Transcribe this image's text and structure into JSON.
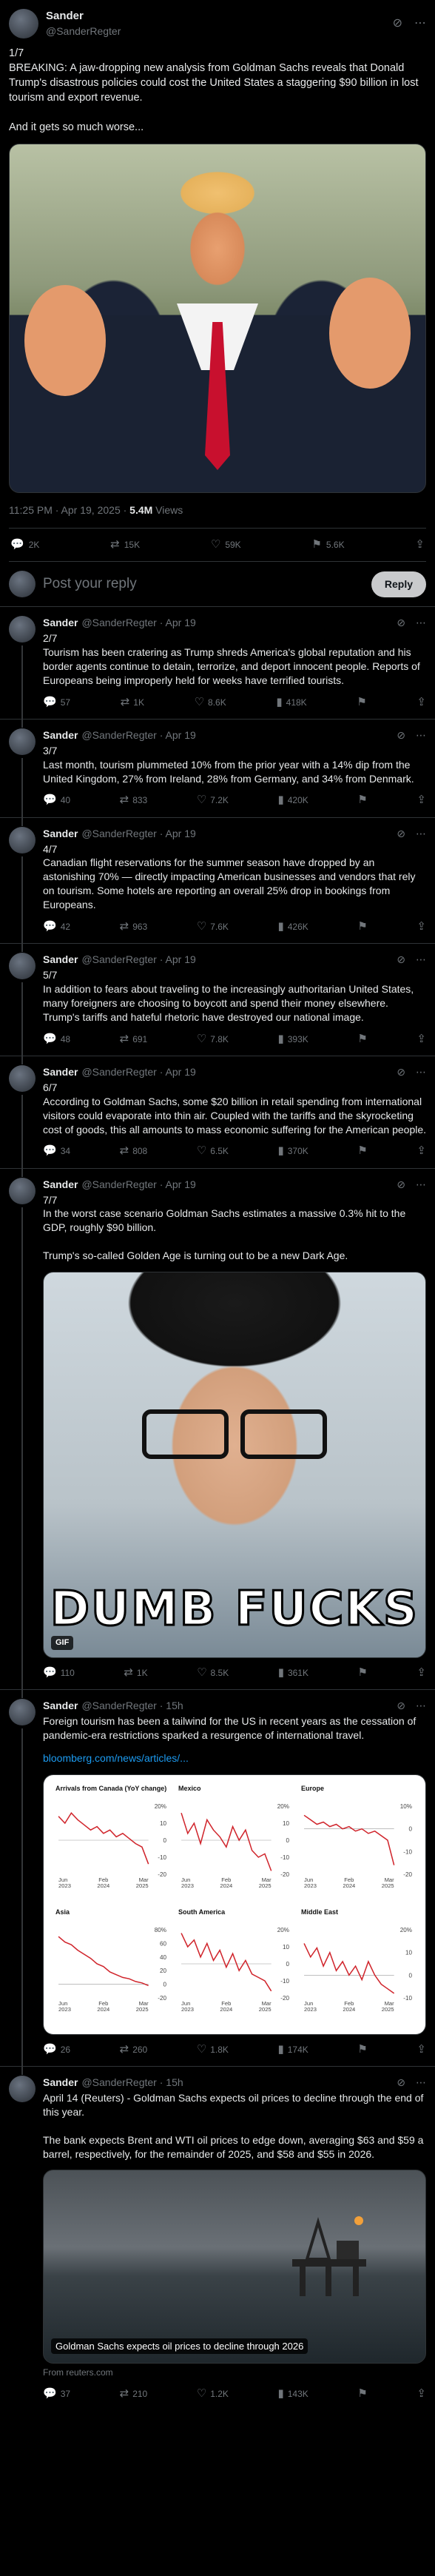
{
  "main": {
    "name": "Sander",
    "handle": "@SanderRegter",
    "text": "1/7\nBREAKING: A jaw-dropping new analysis from Goldman Sachs reveals that Donald Trump's disastrous policies could cost the United States a staggering $90 billion in lost tourism and export revenue.\n\nAnd it gets so much worse...",
    "time": "11:25 PM · Apr 19, 2025 · ",
    "views_count": "5.4M",
    "views_label": " Views",
    "replies": "2K",
    "reposts": "15K",
    "likes": "59K",
    "bookmarks": "5.6K"
  },
  "reply_box": {
    "placeholder": "Post your reply",
    "button": "Reply"
  },
  "thread": [
    {
      "name": "Sander",
      "handle": "@SanderRegter · Apr 19",
      "text": "2/7\nTourism has been cratering as Trump shreds America's global reputation and his border agents continue to detain, terrorize, and deport innocent people. Reports of Europeans being improperly held for weeks have terrified tourists.",
      "replies": "57",
      "reposts": "1K",
      "likes": "8.6K",
      "views": "418K"
    },
    {
      "name": "Sander",
      "handle": "@SanderRegter · Apr 19",
      "text": "3/7\nLast month, tourism plummeted 10% from the prior year with a 14% dip from the United Kingdom, 27% from Ireland, 28% from Germany, and 34% from Denmark.",
      "replies": "40",
      "reposts": "833",
      "likes": "7.2K",
      "views": "420K"
    },
    {
      "name": "Sander",
      "handle": "@SanderRegter · Apr 19",
      "text": "4/7\nCanadian flight reservations for the summer season have dropped by an astonishing 70% — directly impacting American businesses and vendors that rely on tourism. Some hotels are reporting an overall 25% drop in bookings from Europeans.",
      "replies": "42",
      "reposts": "963",
      "likes": "7.6K",
      "views": "426K"
    },
    {
      "name": "Sander",
      "handle": "@SanderRegter · Apr 19",
      "text": "5/7\nIn addition to fears about traveling to the increasingly authoritarian United States, many foreigners are choosing to boycott and spend their money elsewhere. Trump's tariffs and hateful rhetoric have destroyed our national image.",
      "replies": "48",
      "reposts": "691",
      "likes": "7.8K",
      "views": "393K"
    },
    {
      "name": "Sander",
      "handle": "@SanderRegter · Apr 19",
      "text": "6/7\nAccording to Goldman Sachs, some $20 billion in retail spending from international visitors could evaporate into thin air. Coupled with the tariffs and the skyrocketing cost of goods, this all amounts to mass economic suffering for the American people.",
      "replies": "34",
      "reposts": "808",
      "likes": "6.5K",
      "views": "370K"
    }
  ],
  "t7": {
    "name": "Sander",
    "handle": "@SanderRegter · Apr 19",
    "text": "7/7\nIn the worst case scenario Goldman Sachs estimates a massive 0.3% hit to the GDP, roughly $90 billion.\n\nTrump's so-called Golden Age is turning out to be a new Dark Age.",
    "gif_caption": "DUMB FUCKS",
    "gif_badge": "GIF",
    "replies": "110",
    "reposts": "1K",
    "likes": "8.5K",
    "views": "361K"
  },
  "t8": {
    "name": "Sander",
    "handle": "@SanderRegter · 15h",
    "text": "Foreign tourism has been a tailwind for the US in recent years as the cessation of pandemic-era restrictions sparked a resurgence of international travel.",
    "link": "bloomberg.com/news/articles/...",
    "replies": "26",
    "reposts": "260",
    "likes": "1.8K",
    "views": "174K"
  },
  "t9": {
    "name": "Sander",
    "handle": "@SanderRegter · 15h",
    "text": "April 14 (Reuters) - Goldman Sachs expects oil prices to decline through the end of this year.\n\nThe bank expects Brent and WTI oil prices to edge down, averaging $63 and $59 a barrel, respectively, for the remainder of 2025, and $58 and $55 in 2026.",
    "card_caption": "Goldman Sachs expects oil prices to decline through 2026",
    "source": "From reuters.com",
    "replies": "37",
    "reposts": "210",
    "likes": "1.2K",
    "views": "143K"
  },
  "chart_data": [
    {
      "type": "line",
      "title": "Arrivals from Canada (YoY change)",
      "x": [
        "Jun 2023",
        "Feb 2024",
        "Mar 2025"
      ],
      "ylim": [
        -20,
        20
      ],
      "yticks": [
        "20%",
        "10",
        "0",
        "-10",
        "-20"
      ],
      "series": [
        {
          "values": [
            14,
            10,
            16,
            12,
            9,
            6,
            8,
            4,
            6,
            2,
            4,
            1,
            -2,
            -4,
            -14
          ]
        }
      ]
    },
    {
      "type": "line",
      "title": "Mexico",
      "x": [
        "Jun 2023",
        "Feb 2024",
        "Mar 2025"
      ],
      "ylim": [
        -20,
        20
      ],
      "yticks": [
        "20%",
        "10",
        "0",
        "-10",
        "-20"
      ],
      "series": [
        {
          "values": [
            16,
            4,
            10,
            -2,
            12,
            6,
            2,
            -4,
            8,
            0,
            6,
            -6,
            -10,
            -8,
            -18
          ]
        }
      ]
    },
    {
      "type": "line",
      "title": "Europe",
      "x": [
        "Jun 2023",
        "Feb 2024",
        "Mar 2025"
      ],
      "ylim": [
        -20,
        10
      ],
      "yticks": [
        "10%",
        "0",
        "-10",
        "-20"
      ],
      "series": [
        {
          "values": [
            6,
            4,
            2,
            3,
            1,
            2,
            0,
            1,
            -1,
            0,
            -2,
            -1,
            -3,
            -5,
            -16
          ]
        }
      ]
    },
    {
      "type": "line",
      "title": "Asia",
      "x": [
        "Jun 2023",
        "Feb 2024",
        "Mar 2025"
      ],
      "ylim": [
        -20,
        80
      ],
      "yticks": [
        "80%",
        "60",
        "40",
        "20",
        "0",
        "-20"
      ],
      "series": [
        {
          "values": [
            70,
            62,
            58,
            50,
            44,
            38,
            30,
            26,
            18,
            14,
            10,
            8,
            4,
            2,
            -2
          ]
        }
      ]
    },
    {
      "type": "line",
      "title": "South America",
      "x": [
        "Jun 2023",
        "Feb 2024",
        "Mar 2025"
      ],
      "ylim": [
        -20,
        20
      ],
      "yticks": [
        "20%",
        "10",
        "0",
        "-10",
        "-20"
      ],
      "series": [
        {
          "values": [
            18,
            10,
            14,
            4,
            12,
            2,
            8,
            -2,
            6,
            -4,
            2,
            -6,
            -8,
            -10,
            -16
          ]
        }
      ]
    },
    {
      "type": "line",
      "title": "Middle East",
      "x": [
        "Jun 2023",
        "Feb 2024",
        "Mar 2025"
      ],
      "ylim": [
        -10,
        20
      ],
      "yticks": [
        "20%",
        "10",
        "0",
        "-10"
      ],
      "series": [
        {
          "values": [
            14,
            8,
            12,
            4,
            10,
            2,
            6,
            0,
            4,
            -2,
            6,
            0,
            -4,
            -6,
            -8
          ]
        }
      ]
    }
  ]
}
